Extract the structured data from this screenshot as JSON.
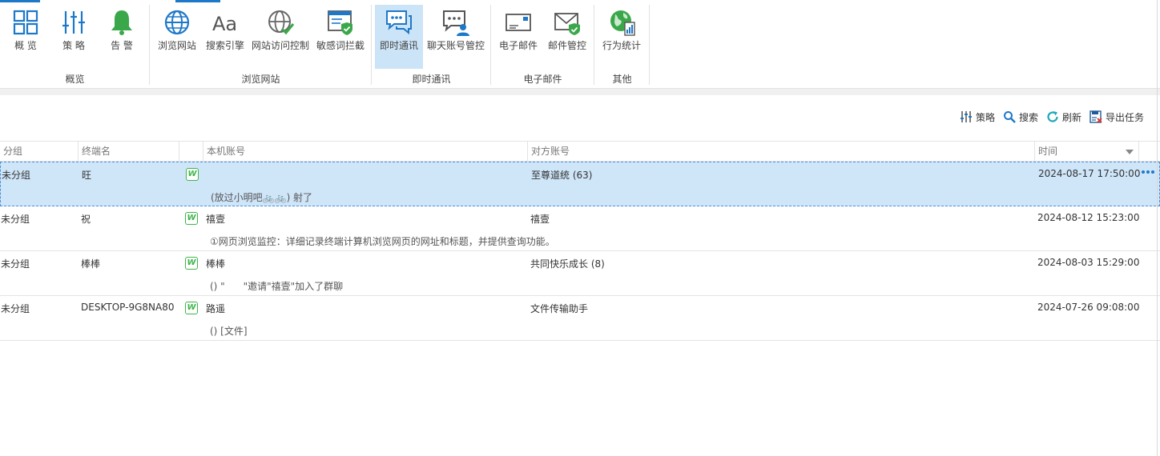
{
  "ribbon": {
    "groups": [
      {
        "name": "概览",
        "buttons": [
          {
            "label": "概 览",
            "icon": "overview-grid-icon"
          },
          {
            "label": "策 略",
            "icon": "policy-sliders-icon"
          },
          {
            "label": "告 警",
            "icon": "alarm-bell-icon"
          }
        ]
      },
      {
        "name": "浏览网站",
        "buttons": [
          {
            "label": "浏览网站",
            "icon": "globe-icon"
          },
          {
            "label": "搜索引擎",
            "icon": "search-engine-aa-icon"
          },
          {
            "label": "网站访问控制",
            "icon": "globe-check-icon"
          },
          {
            "label": "敏感词拦截",
            "icon": "window-shield-icon"
          }
        ]
      },
      {
        "name": "即时通讯",
        "buttons": [
          {
            "label": "即时通讯",
            "icon": "chat-bubbles-icon"
          },
          {
            "label": "聊天账号管控",
            "icon": "chat-user-icon"
          }
        ]
      },
      {
        "name": "电子邮件",
        "buttons": [
          {
            "label": "电子邮件",
            "icon": "email-icon"
          },
          {
            "label": "邮件管控",
            "icon": "email-shield-icon"
          }
        ]
      },
      {
        "name": "其他",
        "buttons": [
          {
            "label": "行为统计",
            "icon": "globe-stats-icon"
          }
        ]
      }
    ]
  },
  "toolbar": {
    "policy": "策略",
    "search": "搜索",
    "refresh": "刷新",
    "export": "导出任务"
  },
  "table": {
    "columns": [
      "分组",
      "终端名",
      "本机账号",
      "对方账号",
      "时间"
    ],
    "rows": [
      {
        "group": "未分组",
        "terminal": "旺",
        "local": "",
        "peer": "至尊道统 (63)",
        "time": "2024-08-17 17:50:00",
        "message": "(放过小明吧🚲🚲) 射了",
        "selected": true
      },
      {
        "group": "未分组",
        "terminal": "祝",
        "local": "禧壹",
        "peer": "禧壹",
        "time": "2024-08-12 15:23:00",
        "message": "①网页浏览监控：详细记录终端计算机浏览网页的网址和标题，并提供查询功能。",
        "selected": false
      },
      {
        "group": "未分组",
        "terminal": "棒棒",
        "local": "棒棒",
        "peer": "共同快乐成长 (8)",
        "time": "2024-08-03 15:29:00",
        "message": "() \"      \"邀请\"禧壹\"加入了群聊",
        "selected": false
      },
      {
        "group": "未分组",
        "terminal": "DESKTOP-9G8NA80",
        "local": "路遥",
        "peer": "文件传输助手",
        "time": "2024-07-26 09:08:00",
        "message": "() [文件]",
        "selected": false
      }
    ]
  },
  "colors": {
    "accent": "#1e78c8",
    "selected_row": "#cfe5f8",
    "active_button": "#cce4f7",
    "wechat_green": "#3db54a",
    "alarm_green": "#3aa84a"
  }
}
